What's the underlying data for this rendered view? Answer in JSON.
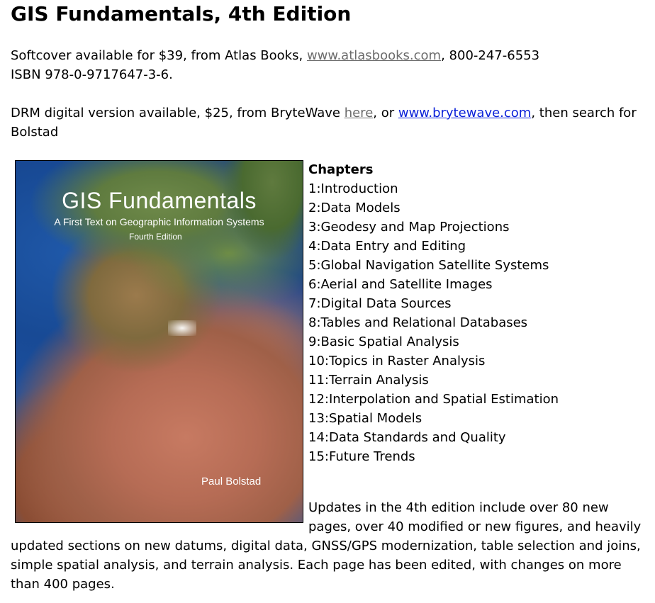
{
  "heading": "GIS Fundamentals, 4th Edition",
  "softcover": {
    "prefix": "Softcover available for $39, from Atlas Books, ",
    "link_text": "www.atlasbooks.com",
    "suffix": ", 800-247-6553",
    "isbn": "ISBN 978-0-9717647-3-6."
  },
  "digital": {
    "prefix": "DRM digital version available, $25, from BryteWave ",
    "here_link": "here",
    "middle": ", or ",
    "brytewave_link": "www.brytewave.com",
    "suffix": ", then search for Bolstad"
  },
  "cover": {
    "title": "GIS Fundamentals",
    "subtitle": "A First Text on Geographic Information Systems",
    "edition": "Fourth Edition",
    "author": "Paul Bolstad"
  },
  "chapters": {
    "heading": "Chapters",
    "items": [
      "1:Introduction",
      "2:Data Models",
      "3:Geodesy and Map Projections",
      "4:Data Entry and Editing",
      "5:Global Navigation Satellite Systems",
      "6:Aerial and Satellite Images",
      "7:Digital Data Sources",
      "8:Tables and Relational Databases",
      "9:Basic Spatial Analysis",
      "10:Topics in Raster Analysis",
      "11:Terrain Analysis",
      "12:Interpolation and Spatial Estimation",
      "13:Spatial Models",
      "14:Data Standards and Quality",
      "15:Future Trends"
    ]
  },
  "updates": "Updates in the 4th edition include over 80 new pages, over 40 modified or new figures, and heavily updated sections on new datums, digital data, GNSS/GPS modernization, table selection and joins, simple spatial analysis, and terrain analysis. Each page has been edited, with changes on more than 400 pages."
}
